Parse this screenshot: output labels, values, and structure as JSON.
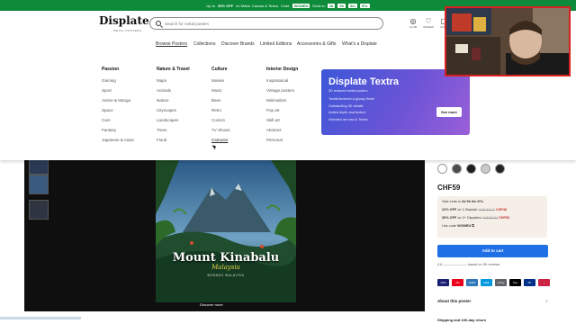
{
  "promo": {
    "text_before": "Up to",
    "discount": "30% OFF",
    "text_after": "on Metal, Canvas & Textra",
    "code_label": "Code",
    "code": "WOMEN",
    "ends_label": "Ends in",
    "d": "2d",
    "h": "9h",
    "m": "0m",
    "s": "57s"
  },
  "header": {
    "logo": "Displate",
    "logo_sub": "METAL POSTERS",
    "search_placeholder": "Search for metal posters",
    "icons": [
      {
        "icon": "currency-icon",
        "label": "CLUB"
      },
      {
        "icon": "heart-icon",
        "label": "WISHES"
      },
      {
        "icon": "cart-icon",
        "label": "CART"
      }
    ]
  },
  "nav": {
    "items": [
      "Browse Posters",
      "Collections",
      "Discover Brands",
      "Limited Editions",
      "Accessories & Gifts",
      "What's a Displate"
    ]
  },
  "mega": {
    "columns": [
      {
        "title": "Passion",
        "links": [
          "Gaming",
          "Sport",
          "Anime & Manga",
          "Space",
          "Cars",
          "Fantasy",
          "Japanese & Asian"
        ]
      },
      {
        "title": "Nature & Travel",
        "links": [
          "Maps",
          "Animals",
          "Nature",
          "Cityscapes",
          "Landscapes",
          "Trees",
          "Floral"
        ]
      },
      {
        "title": "Culture",
        "links": [
          "Movies",
          "Music",
          "Bees",
          "Retro",
          "Comics",
          "TV Shows",
          "Cartoons"
        ]
      },
      {
        "title": "Interior Design",
        "links": [
          "Inspirational",
          "Vintage posters",
          "Minimalism",
          "Pop art",
          "Skill art",
          "Abstract",
          "Personal"
        ]
      }
    ],
    "promo": {
      "title": "Displate Textra",
      "subtitle": "3D textured metal posters",
      "bullets": [
        "Tactile/textured & glossy finish",
        "Outstanding 3D details",
        "Added depth and texture",
        "Selected art now in Textra"
      ],
      "button": "See more"
    }
  },
  "product": {
    "poster_title": "Mount Kinabalu",
    "poster_subtitle": "Malaysia",
    "poster_caption": "BORNEO MALAYSIA",
    "discover": "Discover more",
    "price": "CHF59",
    "sale_line": "Sale ends in",
    "sale_d": "2d",
    "sale_h": "9h",
    "sale_m": "0m",
    "sale_s": "57s",
    "offer1_pct": "22% OFF",
    "offer1_text": "on 1 Displate",
    "offer1_old": "CHF 45.12",
    "offer1_new": "CHF48",
    "offer2_pct": "30% OFF",
    "offer2_text": "on 2+ Displates",
    "offer2_old": "CHF55.64",
    "offer2_new": "CHF53",
    "code_label": "Use code",
    "code": "WOMEN",
    "add_to_cart": "Add to cart",
    "reviews": "4.6 ——————— based on 5K reviews",
    "about": "About this poster",
    "shipping": "Shipping and 100-day return"
  },
  "swatches": [
    "#ffffff",
    "#4d4d4d",
    "#1c1c1c",
    "#c9c9c9",
    "#222222"
  ],
  "payments": [
    {
      "label": "VISA",
      "color": "#1a1f71"
    },
    {
      "label": "MC",
      "color": "#eb001b"
    },
    {
      "label": "AMEX",
      "color": "#2e77bb"
    },
    {
      "label": "MAE",
      "color": "#0099df"
    },
    {
      "label": "G Pay",
      "color": "#5f6368"
    },
    {
      "label": "Pay",
      "color": "#000000"
    },
    {
      "label": "PP",
      "color": "#003087"
    },
    {
      "label": "›",
      "color": "#cc2244"
    }
  ],
  "colors": {
    "accent": "#1f6fe5",
    "promo_bg": "#0d8a3a"
  }
}
